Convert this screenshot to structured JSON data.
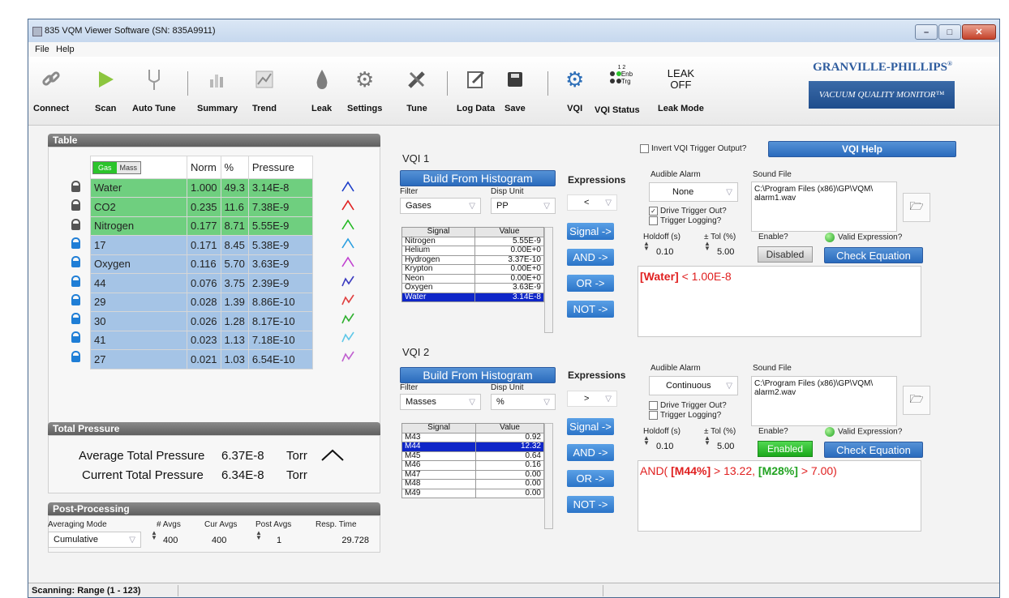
{
  "window": {
    "title": "835 VQM Viewer Software (SN: 835A9911)"
  },
  "menu": [
    "File",
    "Help"
  ],
  "toolbar": {
    "connect": "Connect",
    "scan": "Scan",
    "auto_tune": "Auto Tune",
    "summary": "Summary",
    "trend": "Trend",
    "leak": "Leak",
    "settings": "Settings",
    "tune": "Tune",
    "log_data": "Log Data",
    "save": "Save",
    "vqi": "VQI",
    "vqi_status": "VQI Status",
    "leak_mode": "Leak Mode",
    "status_nums": "1 2",
    "enb": "Enb",
    "trg": "Trg",
    "leak_state_1": "LEAK",
    "leak_state_2": "OFF"
  },
  "brand": {
    "name": "GRANVILLE-PHILLIPS",
    "reg": "®",
    "tagline": "VACUUM QUALITY MONITOR™"
  },
  "table_section": {
    "title": "Table",
    "toggle_gas": "Gas",
    "toggle_mass": "Mass",
    "headers": [
      "Norm",
      "%",
      "Pressure"
    ],
    "rows": [
      {
        "name": "Water",
        "norm": "1.000",
        "pct": "49.3",
        "pressure": "3.14E-8",
        "type": "gas",
        "color": "#1a3cc8"
      },
      {
        "name": "CO2",
        "norm": "0.235",
        "pct": "11.6",
        "pressure": "7.38E-9",
        "type": "gas",
        "color": "#e02020"
      },
      {
        "name": "Nitrogen",
        "norm": "0.177",
        "pct": "8.71",
        "pressure": "5.55E-9",
        "type": "gas",
        "color": "#22b822"
      },
      {
        "name": "17",
        "norm": "0.171",
        "pct": "8.45",
        "pressure": "5.38E-9",
        "type": "mass",
        "color": "#2a9ee0"
      },
      {
        "name": "Oxygen",
        "norm": "0.116",
        "pct": "5.70",
        "pressure": "3.63E-9",
        "type": "mass",
        "color": "#c040d0"
      },
      {
        "name": "44",
        "norm": "0.076",
        "pct": "3.75",
        "pressure": "2.39E-9",
        "type": "mass",
        "color": "#3c3cc0"
      },
      {
        "name": "29",
        "norm": "0.028",
        "pct": "1.39",
        "pressure": "8.86E-10",
        "type": "mass",
        "color": "#e04040"
      },
      {
        "name": "30",
        "norm": "0.026",
        "pct": "1.28",
        "pressure": "8.17E-10",
        "type": "mass",
        "color": "#30b030"
      },
      {
        "name": "41",
        "norm": "0.023",
        "pct": "1.13",
        "pressure": "7.18E-10",
        "type": "mass",
        "color": "#60c8e8"
      },
      {
        "name": "27",
        "norm": "0.021",
        "pct": "1.03",
        "pressure": "6.54E-10",
        "type": "mass",
        "color": "#c060d0"
      }
    ]
  },
  "total_pressure": {
    "title": "Total Pressure",
    "avg_label": "Average Total Pressure",
    "avg_value": "6.37E-8",
    "avg_unit": "Torr",
    "cur_label": "Current Total Pressure",
    "cur_value": "6.34E-8",
    "cur_unit": "Torr"
  },
  "post_processing": {
    "title": "Post-Processing",
    "labels": [
      "Averaging Mode",
      "# Avgs",
      "Cur Avgs",
      "Post Avgs",
      "Resp. Time"
    ],
    "averaging_mode": "Cumulative",
    "num_avgs": "400",
    "cur_avgs": "400",
    "post_avgs": "1",
    "resp_time": "29.728"
  },
  "vqi1": {
    "title": "VQI 1",
    "build_btn": "Build From Histogram",
    "filter_label": "Filter",
    "filter_value": "Gases",
    "disp_unit_label": "Disp Unit",
    "disp_unit_value": "PP",
    "sig_headers": [
      "Signal",
      "Value"
    ],
    "signals": [
      [
        "Nitrogen",
        "5.55E-9"
      ],
      [
        "Helium",
        "0.00E+0"
      ],
      [
        "Hydrogen",
        "3.37E-10"
      ],
      [
        "Krypton",
        "0.00E+0"
      ],
      [
        "Neon",
        "0.00E+0"
      ],
      [
        "Oxygen",
        "3.63E-9"
      ],
      [
        "Water",
        "3.14E-8"
      ]
    ],
    "selected_index": 6,
    "expressions_label": "Expressions",
    "operator": "<",
    "ops": [
      "Signal ->",
      "AND ->",
      "OR ->",
      "NOT ->"
    ],
    "invert_label": "Invert VQI Trigger Output?",
    "help_btn": "VQI Help",
    "audible_label": "Audible Alarm",
    "audible_value": "None",
    "sound_label": "Sound File",
    "sound_path": "C:\\Program Files (x86)\\GP\\VQM\\ alarm1.wav",
    "drive_trigger": "Drive Trigger Out?",
    "trigger_logging": "Trigger Logging?",
    "holdoff_label": "Holdoff (s)",
    "holdoff_value": "0.10",
    "tol_label": "± Tol (%)",
    "tol_value": "5.00",
    "enable_label": "Enable?",
    "enable_state": "Disabled",
    "valid_label": "Valid Expression?",
    "check_btn": "Check Equation",
    "expr_sig": "[Water]",
    "expr_rest": " < 1.00E-8"
  },
  "vqi2": {
    "title": "VQI 2",
    "build_btn": "Build From Histogram",
    "filter_label": "Filter",
    "filter_value": "Masses",
    "disp_unit_label": "Disp Unit",
    "disp_unit_value": "%",
    "sig_headers": [
      "Signal",
      "Value"
    ],
    "signals": [
      [
        "M43",
        "0.92"
      ],
      [
        "M44",
        "12.32"
      ],
      [
        "M45",
        "0.64"
      ],
      [
        "M46",
        "0.16"
      ],
      [
        "M47",
        "0.00"
      ],
      [
        "M48",
        "0.00"
      ],
      [
        "M49",
        "0.00"
      ]
    ],
    "selected_index": 1,
    "expressions_label": "Expressions",
    "operator": ">",
    "ops": [
      "Signal ->",
      "AND ->",
      "OR ->",
      "NOT ->"
    ],
    "audible_label": "Audible Alarm",
    "audible_value": "Continuous",
    "sound_label": "Sound File",
    "sound_path": "C:\\Program Files (x86)\\GP\\VQM\\ alarm2.wav",
    "drive_trigger": "Drive Trigger Out?",
    "trigger_logging": "Trigger Logging?",
    "holdoff_label": "Holdoff (s)",
    "holdoff_value": "0.10",
    "tol_label": "± Tol (%)",
    "tol_value": "5.00",
    "enable_label": "Enable?",
    "enable_state": "Enabled",
    "valid_label": "Valid Expression?",
    "check_btn": "Check Equation",
    "expr_a": "AND( ",
    "expr_b": "[M44%]",
    "expr_c": " > 13.22, ",
    "expr_d": "[M28%]",
    "expr_e": " > 7.00)"
  },
  "status": {
    "text": "Scanning: Range (1 - 123)"
  }
}
